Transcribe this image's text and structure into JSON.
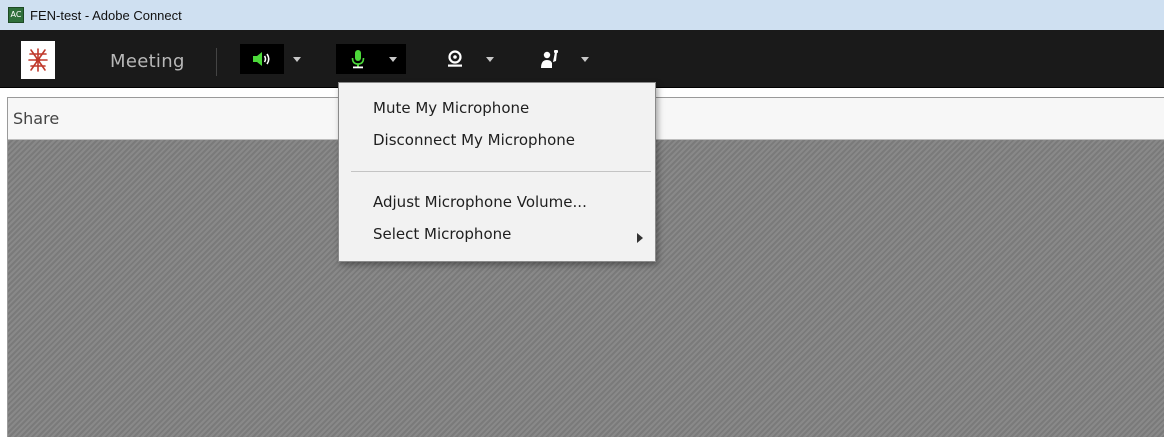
{
  "window": {
    "title": "FEN-test - Adobe Connect",
    "app_icon_glyph": "AC"
  },
  "toolbar": {
    "meeting_label": "Meeting",
    "speaker_icon": "speaker-icon",
    "microphone_icon": "microphone-icon",
    "webcam_icon": "webcam-icon",
    "raise_hand_icon": "raise-hand-icon",
    "colors": {
      "accent_green": "#4cd93a",
      "icon_white": "#ffffff",
      "toolbar_bg": "#1a1a1a"
    }
  },
  "pod": {
    "title": "Share"
  },
  "mic_menu": {
    "items": [
      {
        "label": "Mute My Microphone"
      },
      {
        "label": "Disconnect My Microphone"
      },
      {
        "label": "Adjust Microphone Volume..."
      },
      {
        "label": "Select Microphone",
        "has_submenu": true
      }
    ]
  }
}
